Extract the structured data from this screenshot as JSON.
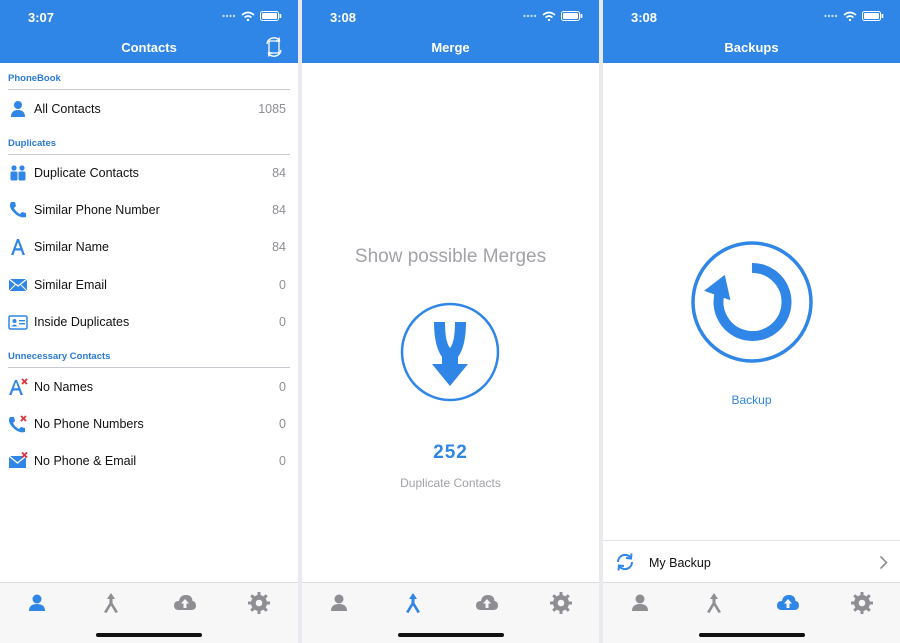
{
  "colors": {
    "accent": "#2f86e6",
    "inactive": "#8e8e93",
    "badge_x": "#e0343a"
  },
  "screen1": {
    "status_time": "3:07",
    "nav_title": "Contacts",
    "nav_right_icon": "sync-contacts-icon",
    "sections": [
      {
        "title": "PhoneBook",
        "rows": [
          {
            "icon": "person-icon",
            "label": "All Contacts",
            "count": "1085"
          }
        ]
      },
      {
        "title": "Duplicates",
        "rows": [
          {
            "icon": "duplicate-people-icon",
            "label": "Duplicate Contacts",
            "count": "84"
          },
          {
            "icon": "phone-icon",
            "label": "Similar Phone Number",
            "count": "84"
          },
          {
            "icon": "letter-a-icon",
            "label": "Similar Name",
            "count": "84"
          },
          {
            "icon": "envelope-icon",
            "label": "Similar Email",
            "count": "0"
          },
          {
            "icon": "id-card-icon",
            "label": "Inside Duplicates",
            "count": "0"
          }
        ]
      },
      {
        "title": "Unnecessary Contacts",
        "rows": [
          {
            "icon": "letter-a-x-icon",
            "label": "No Names",
            "count": "0"
          },
          {
            "icon": "phone-x-icon",
            "label": "No Phone Numbers",
            "count": "0"
          },
          {
            "icon": "envelope-x-icon",
            "label": "No Phone & Email",
            "count": "0"
          }
        ]
      }
    ]
  },
  "screen2": {
    "status_time": "3:08",
    "nav_title": "Merge",
    "headline": "Show possible Merges",
    "merge_icon": "merge-arrow-icon",
    "count": "252",
    "count_label": "Duplicate Contacts"
  },
  "screen3": {
    "status_time": "3:08",
    "nav_title": "Backups",
    "backup_icon": "backup-refresh-icon",
    "backup_label": "Backup",
    "list_item": {
      "icon": "sync-icon",
      "label": "My Backup",
      "chevron": "chevron-right-icon"
    }
  },
  "tabbar": {
    "tabs": [
      "contacts-tab",
      "merge-tab",
      "backup-tab",
      "settings-tab"
    ],
    "active_by_screen": [
      "contacts-tab",
      "merge-tab",
      "backup-tab"
    ]
  }
}
